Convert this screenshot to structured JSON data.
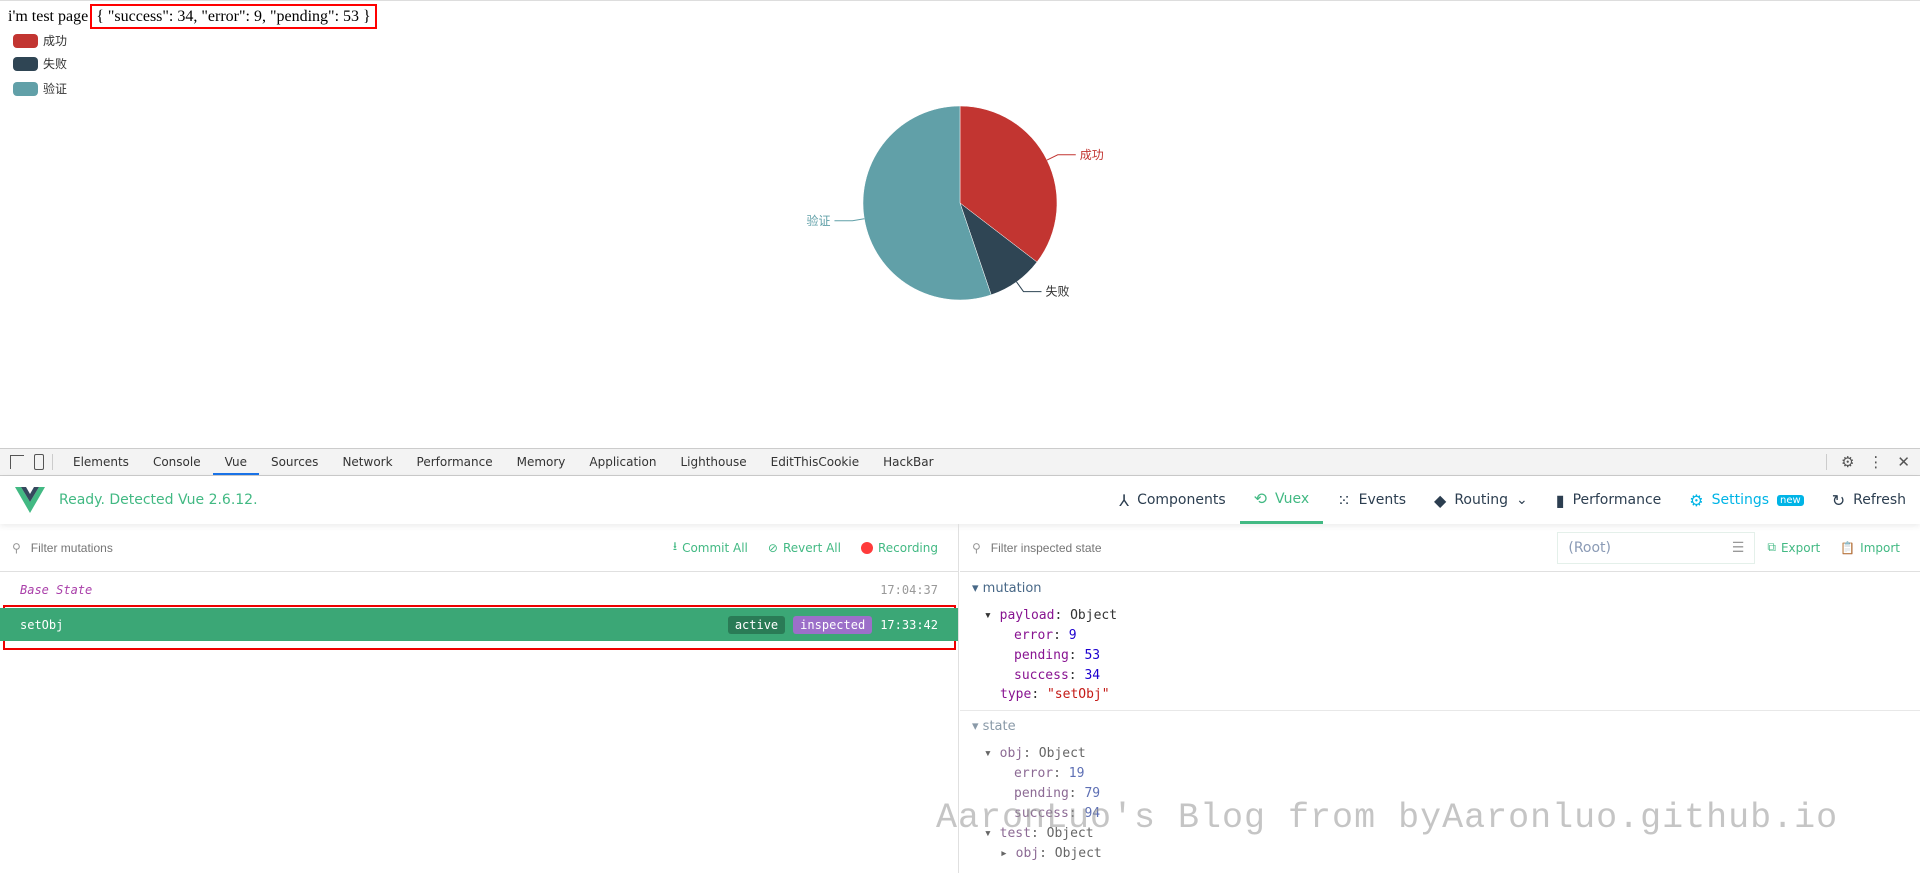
{
  "page": {
    "title": "i'm test page",
    "json_text": "{ \"success\": 34, \"error\": 9, \"pending\": 53 }"
  },
  "chart_data": {
    "type": "pie",
    "categories": [
      "成功",
      "失败",
      "验证"
    ],
    "values": [
      34,
      9,
      53
    ],
    "colors": [
      "#c23531",
      "#2f4554",
      "#61a0a8"
    ],
    "legend_position": "top-left",
    "legend": [
      "成功",
      "失败",
      "验证"
    ]
  },
  "devtools": {
    "tabs": [
      "Elements",
      "Console",
      "Vue",
      "Sources",
      "Network",
      "Performance",
      "Memory",
      "Application",
      "Lighthouse",
      "EditThisCookie",
      "HackBar"
    ],
    "active_tab": "Vue"
  },
  "vue": {
    "status": "Ready. Detected Vue 2.6.12.",
    "nav": [
      {
        "label": "Components",
        "icon": "components-icon"
      },
      {
        "label": "Vuex",
        "icon": "history-icon"
      },
      {
        "label": "Events",
        "icon": "events-icon"
      },
      {
        "label": "Routing",
        "icon": "routing-icon"
      },
      {
        "label": "Performance",
        "icon": "chart-icon"
      },
      {
        "label": "Settings",
        "icon": "gear-icon",
        "badge": "new"
      },
      {
        "label": "Refresh",
        "icon": "refresh-icon"
      }
    ],
    "active_nav": "Vuex",
    "accent": "#42b983"
  },
  "mutations": {
    "filter_placeholder": "Filter mutations",
    "commit_all": "Commit All",
    "revert_all": "Revert All",
    "recording": "Recording",
    "list": [
      {
        "name": "Base State",
        "time": "17:04:37"
      },
      {
        "name": "setObj",
        "time": "17:33:42",
        "badges": [
          "active",
          "inspected"
        ]
      }
    ]
  },
  "inspector": {
    "filter_placeholder": "Filter inspected state",
    "root_select": "(Root)",
    "export": "Export",
    "import": "Import",
    "mutation_label": "mutation",
    "payload_key": "payload",
    "payload_type": "Object",
    "payload": [
      {
        "k": "error",
        "v": "9"
      },
      {
        "k": "pending",
        "v": "53"
      },
      {
        "k": "success",
        "v": "34"
      }
    ],
    "type_key": "type",
    "type_value": "\"setObj\"",
    "state_label": "state",
    "obj_key": "obj",
    "obj_type": "Object",
    "obj": [
      {
        "k": "error",
        "v": "19"
      },
      {
        "k": "pending",
        "v": "79"
      },
      {
        "k": "success",
        "v": "94"
      }
    ],
    "test_key": "test",
    "test_type": "Object",
    "test_obj_key": "obj",
    "test_obj_type": "Object"
  },
  "watermark": "AaronLuo's Blog from byAaronluo.github.io"
}
